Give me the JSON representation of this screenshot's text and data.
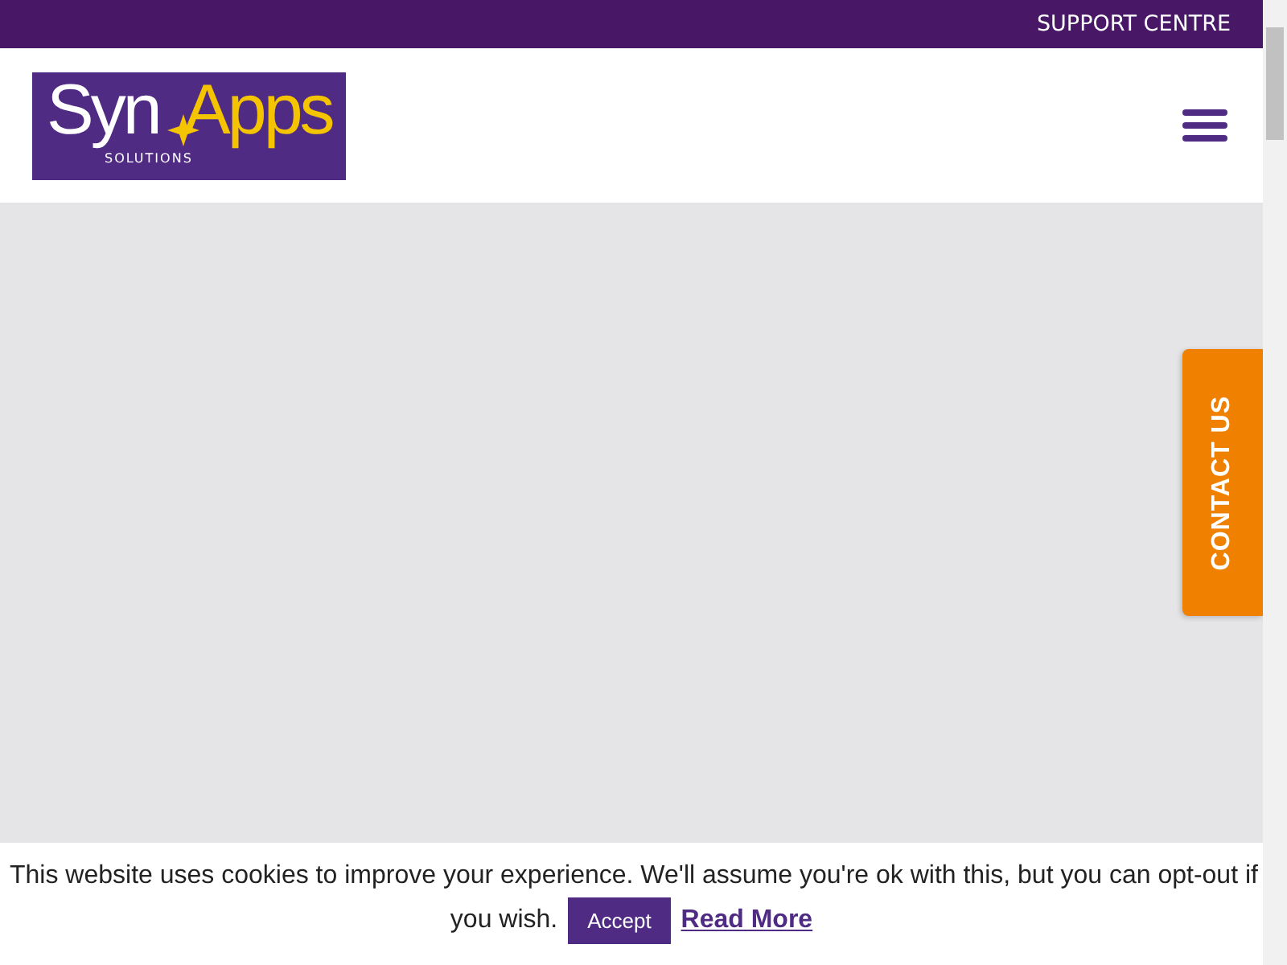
{
  "top_bar": {
    "link": "SUPPORT CENTRE"
  },
  "header": {
    "logo": {
      "word_1": "Syn",
      "word_2": "Apps",
      "tagline": "SOLUTIONS"
    }
  },
  "contact_tab": {
    "label": "CONTACT US"
  },
  "cookie_bar": {
    "message_line_1": "This website uses cookies to improve your experience. We'll assume you're ok with this, but you can opt-out if",
    "message_line_2": "you wish.",
    "accept_button": "Accept",
    "link": "Read More"
  }
}
